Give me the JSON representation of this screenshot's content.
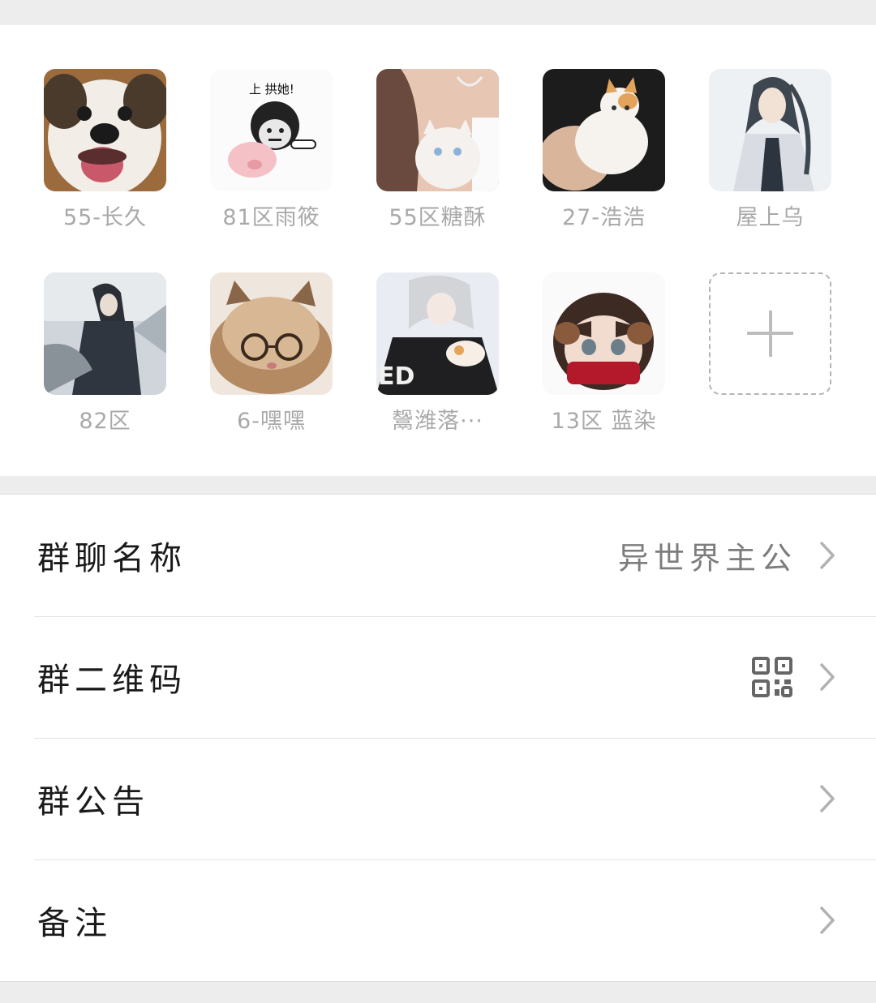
{
  "members": [
    {
      "name": "55-长久",
      "avatar": "dog-avatar"
    },
    {
      "name": "81区雨筱",
      "avatar": "meme-face-avatar"
    },
    {
      "name": "55区糖酥",
      "avatar": "girl-with-cat-avatar"
    },
    {
      "name": "27-浩浩",
      "avatar": "kitten-in-hand-avatar"
    },
    {
      "name": "屋上乌",
      "avatar": "anime-swordsman-avatar"
    },
    {
      "name": "82区",
      "avatar": "anime-dark-figure-avatar"
    },
    {
      "name": "6-嘿嘿",
      "avatar": "cat-with-glasses-avatar"
    },
    {
      "name": "鬶潍落···",
      "avatar": "anime-white-hair-avatar"
    },
    {
      "name": "13区 蓝染",
      "avatar": "chibi-masked-avatar"
    }
  ],
  "add_member": {
    "icon": "plus-icon"
  },
  "settings": {
    "group_name": {
      "label": "群聊名称",
      "value": "异世界主公"
    },
    "group_qr": {
      "label": "群二维码",
      "icon": "qr-code-icon"
    },
    "group_notice": {
      "label": "群公告"
    },
    "remark": {
      "label": "备注"
    }
  },
  "colors": {
    "background": "#ededed",
    "card": "#ffffff",
    "member_name": "#a9a9a9",
    "label": "#1a1a1a",
    "value": "#7d7d7d"
  }
}
